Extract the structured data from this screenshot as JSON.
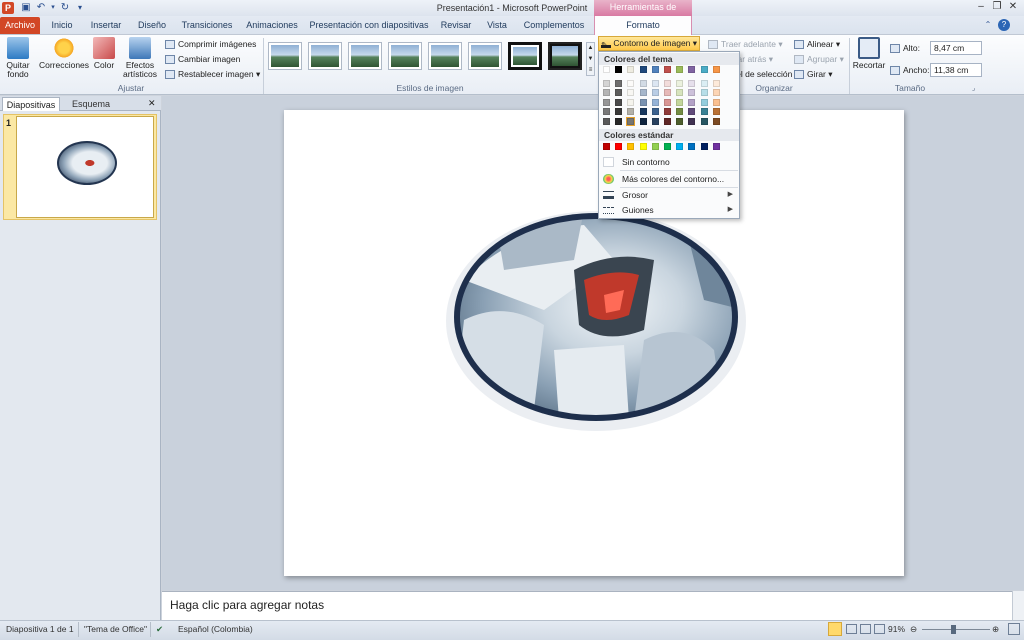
{
  "window": {
    "title": "Presentación1 - Microsoft PowerPoint",
    "context_group": "Herramientas de imagen",
    "app_icon_letter": "P"
  },
  "tabs": [
    "Archivo",
    "Inicio",
    "Insertar",
    "Diseño",
    "Transiciones",
    "Animaciones",
    "Presentación con diapositivas",
    "Revisar",
    "Vista",
    "Complementos",
    "Formato"
  ],
  "ribbon": {
    "ajustar": {
      "label": "Ajustar",
      "quitar_fondo": "Quitar fondo",
      "correcciones": "Correcciones",
      "color": "Color",
      "efectos": "Efectos artísticos",
      "comprimir": "Comprimir imágenes",
      "cambiar": "Cambiar imagen",
      "restablecer": "Restablecer imagen"
    },
    "estilos": {
      "label": "Estilos de imagen",
      "contorno": "Contorno de imagen"
    },
    "organizar": {
      "label": "Organizar",
      "traer": "Traer adelante",
      "enviar": "Enviar atrás",
      "seleccion": "Panel de selección",
      "alinear": "Alinear",
      "agrupar": "Agrupar",
      "girar": "Girar"
    },
    "tamano": {
      "label": "Tamaño",
      "recortar": "Recortar",
      "alto_label": "Alto:",
      "alto_value": "8,47 cm",
      "ancho_label": "Ancho:",
      "ancho_value": "11,38 cm"
    }
  },
  "menu": {
    "theme_header": "Colores del tema",
    "standard_header": "Colores estándar",
    "sin_contorno": "Sin contorno",
    "mas_colores": "Más colores del contorno...",
    "grosor": "Grosor",
    "guiones": "Guiones",
    "theme_colors": [
      "#ffffff",
      "#000000",
      "#eeece1",
      "#1f497d",
      "#4f81bd",
      "#c0504d",
      "#9bbb59",
      "#8064a2",
      "#4bacc6",
      "#f79646"
    ],
    "standard_colors": [
      "#c00000",
      "#ff0000",
      "#ffc000",
      "#ffff00",
      "#92d050",
      "#00b050",
      "#00b0f0",
      "#0070c0",
      "#002060",
      "#7030a0"
    ]
  },
  "panes": {
    "tab_slides": "Diapositivas",
    "tab_outline": "Esquema",
    "slide_number": "1"
  },
  "notes_placeholder": "Haga clic para agregar notas",
  "status": {
    "slide": "Diapositiva 1 de 1",
    "theme": "\"Tema de Office\"",
    "language": "Español (Colombia)",
    "zoom": "91%"
  }
}
